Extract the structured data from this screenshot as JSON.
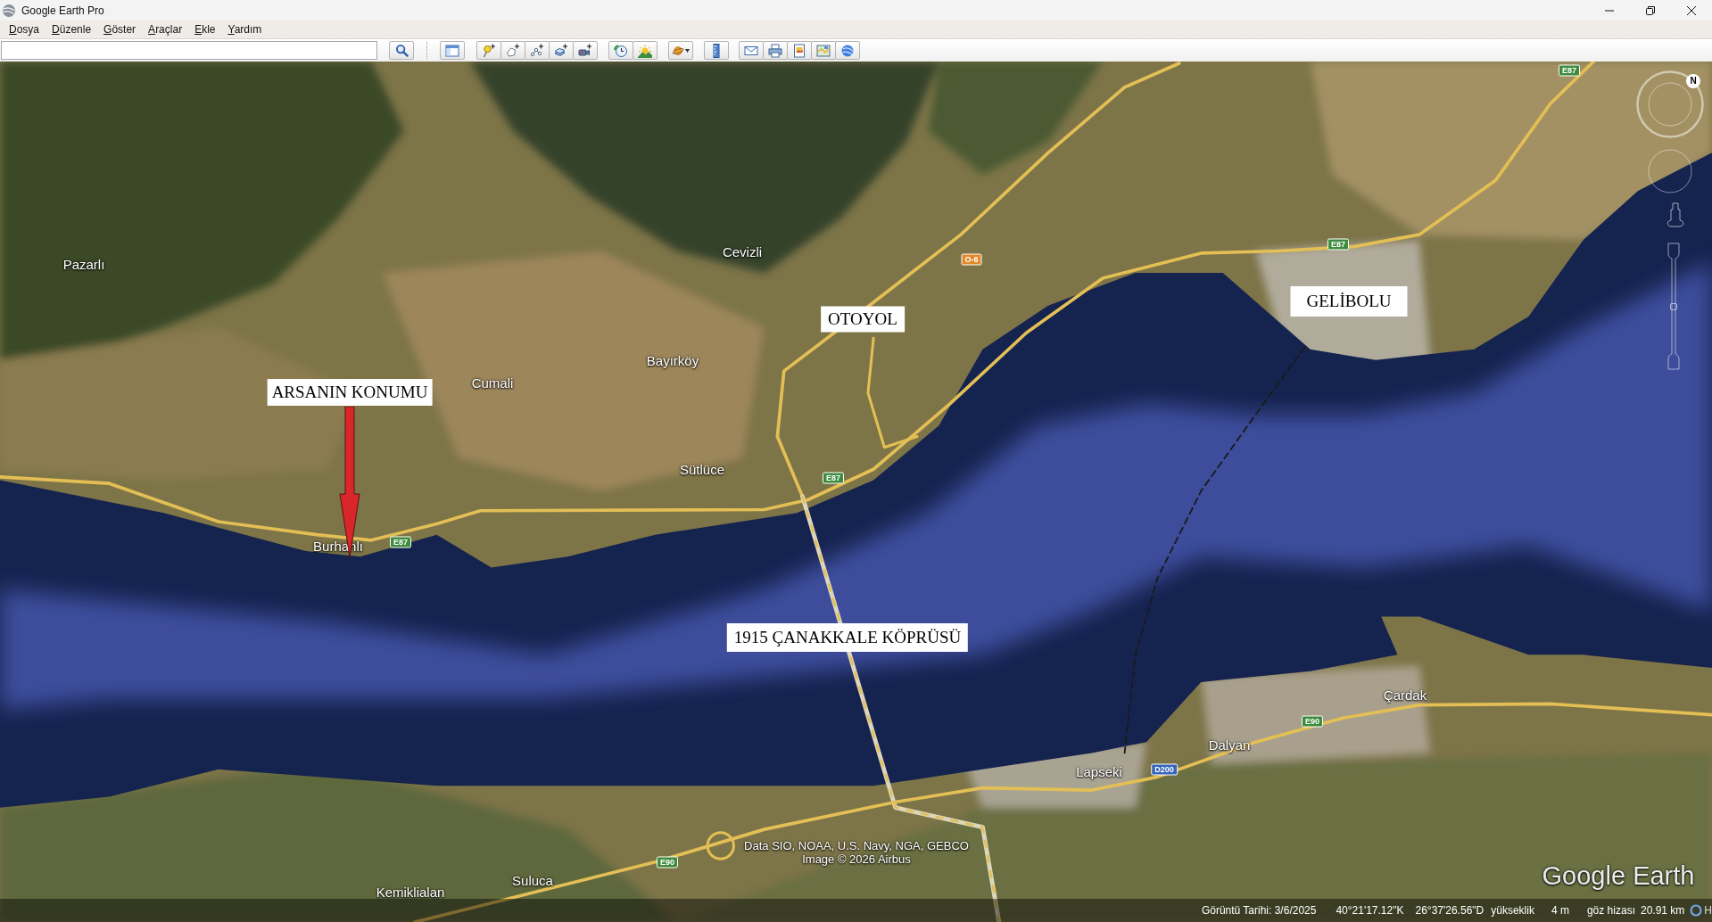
{
  "window": {
    "title": "Google Earth Pro"
  },
  "menu": [
    "Dosya",
    "Düzenle",
    "Göster",
    "Araçlar",
    "Ekle",
    "Yardım"
  ],
  "map": {
    "places": [
      {
        "name": "Cevizli"
      },
      {
        "name": "Pazarlı"
      },
      {
        "name": "Bayırköy"
      },
      {
        "name": "Cumali"
      },
      {
        "name": "Sütlüce"
      },
      {
        "name": "Burhanlı"
      },
      {
        "name": "Çardak"
      },
      {
        "name": "Dalyan"
      },
      {
        "name": "Lapseki"
      },
      {
        "name": "Suluca"
      },
      {
        "name": "Kemiklialan"
      }
    ],
    "road_shields": [
      {
        "label": "E87",
        "color": "#3d8b3d"
      },
      {
        "label": "E87",
        "color": "#3d8b3d"
      },
      {
        "label": "O-6",
        "color": "#e3892b"
      },
      {
        "label": "E87",
        "color": "#3d8b3d"
      },
      {
        "label": "E87",
        "color": "#3d8b3d"
      },
      {
        "label": "E90",
        "color": "#3d8b3d"
      },
      {
        "label": "D200",
        "color": "#3566b8"
      },
      {
        "label": "E90",
        "color": "#3d8b3d"
      }
    ],
    "annotations": [
      {
        "text": "GELİBOLU"
      },
      {
        "text": "OTOYOL"
      },
      {
        "text": "ARSANIN KONUMU"
      },
      {
        "text": "1915 ÇANAKKALE KÖPRÜSÜ"
      }
    ],
    "attribution": [
      "Data SIO, NOAA, U.S. Navy, NGA, GEBCO",
      "Image © 2026 Airbus"
    ],
    "logo": "Google Earth",
    "compass_north": "N",
    "zoom_slider": {
      "level": 0.5
    }
  },
  "status_bar": {
    "image_date": "Görüntü Tarihi: 3/6/2025",
    "latitude": "40°21'17.12\"K",
    "longitude": "26°37'26.56\"D",
    "elevation_label": "yükseklik",
    "elevation": "4 m",
    "eye_altitude_label": "göz hizası",
    "eye_altitude": "20.91 km",
    "trailing_text": "H"
  }
}
